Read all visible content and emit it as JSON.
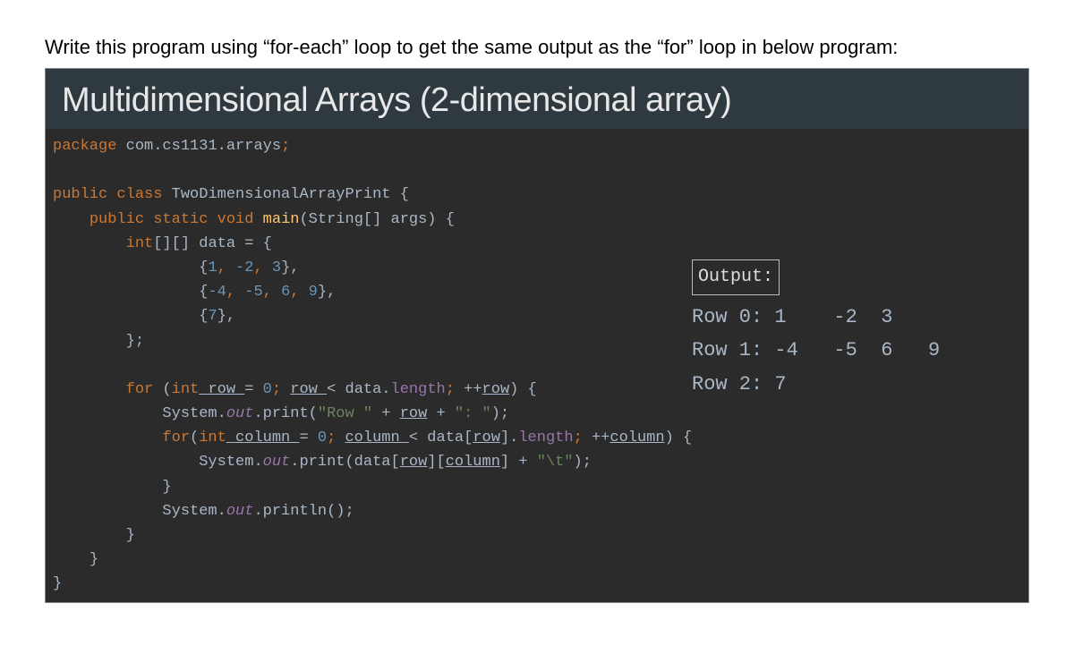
{
  "instruction": "Write this program using “for-each” loop to get the same output as the “for” loop in below program:",
  "slide_title": "Multidimensional Arrays (2-dimensional array)",
  "code": {
    "t_package": "package",
    "t_pkgname": " com.cs1131.arrays",
    "t_semi1": ";",
    "t_public": "public",
    "t_class": " class",
    "t_classname": " TwoDimensionalArrayPrint ",
    "t_brace_open": "{",
    "t_public2": "public",
    "t_static": " static",
    "t_void": " void",
    "t_main": " main",
    "t_mainargs": "(String[] args) {",
    "t_int": "int",
    "t_arraydecl": "[][] data = {",
    "t_row0a": "{",
    "t_row0_1": "1",
    "t_row0_c1": ", ",
    "t_row0_m2": "-2",
    "t_row0_c2": ", ",
    "t_row0_3": "3",
    "t_row0b": "},",
    "t_row1a": "{",
    "t_row1_m4": "-4",
    "t_row1_c1": ", ",
    "t_row1_m5": "-5",
    "t_row1_c2": ", ",
    "t_row1_6": "6",
    "t_row1_c3": ", ",
    "t_row1_9": "9",
    "t_row1b": "},",
    "t_row2a": "{",
    "t_row2_7": "7",
    "t_row2b": "},",
    "t_endarray": "};",
    "t_for": "for",
    "t_for_open": " (",
    "t_int2": "int",
    "t_row": " row ",
    "t_eq": "= ",
    "t_zero": "0",
    "t_semicol": "; ",
    "t_row2v": "row ",
    "t_lt": "< data.",
    "t_length": "length",
    "t_semicol2": "; ",
    "t_incr": "++",
    "t_rowvar": "row",
    "t_forend": ") {",
    "t_sys": "System.",
    "t_out": "out",
    "t_print": ".print(",
    "t_str1": "\"Row \"",
    "t_plus": " + ",
    "t_rowv2": "row",
    "t_plus2": " + ",
    "t_str2": "\": \"",
    "t_close1": ");",
    "t_for2": "for",
    "t_for2_open": "(",
    "t_int3": "int",
    "t_column": " column ",
    "t_eq2": "= ",
    "t_zero2": "0",
    "t_semicol3": "; ",
    "t_columnv": "column ",
    "t_lt2": "< data[",
    "t_rowv3": "row",
    "t_bracket": "].",
    "t_length2": "length",
    "t_semicol4": "; ",
    "t_incr2": "++",
    "t_columnvar": "column",
    "t_for2end": ") {",
    "t_sys2": "System.",
    "t_out2": "out",
    "t_print2": ".print(data[",
    "t_rowv4": "row",
    "t_brk1": "][",
    "t_colv": "column",
    "t_brk2": "] + ",
    "t_str3": "\"\\t\"",
    "t_close2": ");",
    "t_brc1": "}",
    "t_sys3": "System.",
    "t_out3": "out",
    "t_println": ".println();",
    "t_brc2": "}",
    "t_brc3": "}",
    "t_brc4": "}"
  },
  "output": {
    "label": "Output:",
    "rows": "Row 0: 1    -2  3\nRow 1: -4   -5  6   9\nRow 2: 7"
  }
}
